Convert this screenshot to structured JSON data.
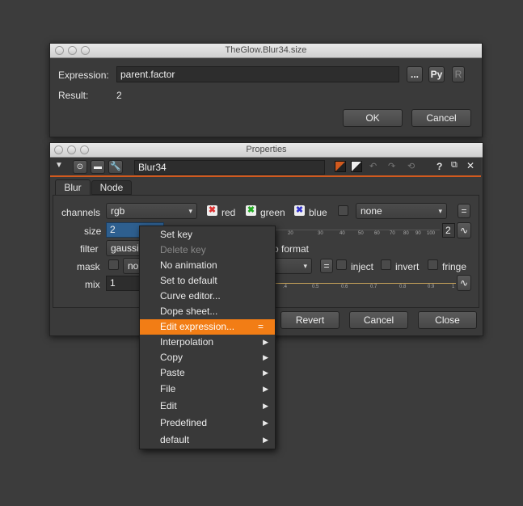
{
  "expr_dialog": {
    "title": "TheGlow.Blur34.size",
    "expression_label": "Expression:",
    "expression_value": "parent.factor",
    "dots_button": "...",
    "py_button": "Py",
    "r_button": "R",
    "result_label": "Result:",
    "result_value": "2",
    "ok_button": "OK",
    "cancel_button": "Cancel"
  },
  "properties": {
    "title": "Properties",
    "node_name": "Blur34",
    "help_button": "?",
    "tabs": [
      "Blur",
      "Node"
    ],
    "channels_label": "channels",
    "channels_value": "rgb",
    "red_label": "red",
    "green_label": "green",
    "blue_label": "blue",
    "alpha_channel_value": "none",
    "equals_button": "=",
    "size_label": "size",
    "size_value": "2",
    "size_box_value": "2",
    "size_ticks": [
      "20",
      "30",
      "40",
      "50",
      "60",
      "70",
      "80",
      "90",
      "100"
    ],
    "filter_label": "filter",
    "filter_value": "gaussia",
    "filter_extra": "o format",
    "mask_label": "mask",
    "mask_value": "no",
    "inject_label": "inject",
    "invert_label": "invert",
    "fringe_label": "fringe",
    "mix_label": "mix",
    "mix_value": "1",
    "mix_ticks": [
      ".4",
      "0.5",
      "0.6",
      "0.7",
      "0.8",
      "0.9",
      "1"
    ],
    "revert_button": "Revert",
    "cancel_button": "Cancel",
    "close_button": "Close"
  },
  "context_menu": {
    "items": [
      {
        "label": "Set key"
      },
      {
        "label": "Delete key"
      },
      {
        "label": "No animation"
      },
      {
        "label": "Set to default"
      },
      {
        "label": "Curve editor..."
      },
      {
        "label": "Dope sheet..."
      },
      {
        "label": "Edit expression...",
        "shortcut": "="
      },
      {
        "label": "Interpolation"
      },
      {
        "label": "Copy"
      },
      {
        "label": "Paste"
      },
      {
        "label": "File"
      },
      {
        "label": "Edit"
      },
      {
        "label": "Predefined"
      },
      {
        "label": "default"
      }
    ]
  },
  "colors": {
    "highlight": "#f27d15",
    "size_field": "#2e5f8f",
    "accent_line": "#d25a1e"
  }
}
